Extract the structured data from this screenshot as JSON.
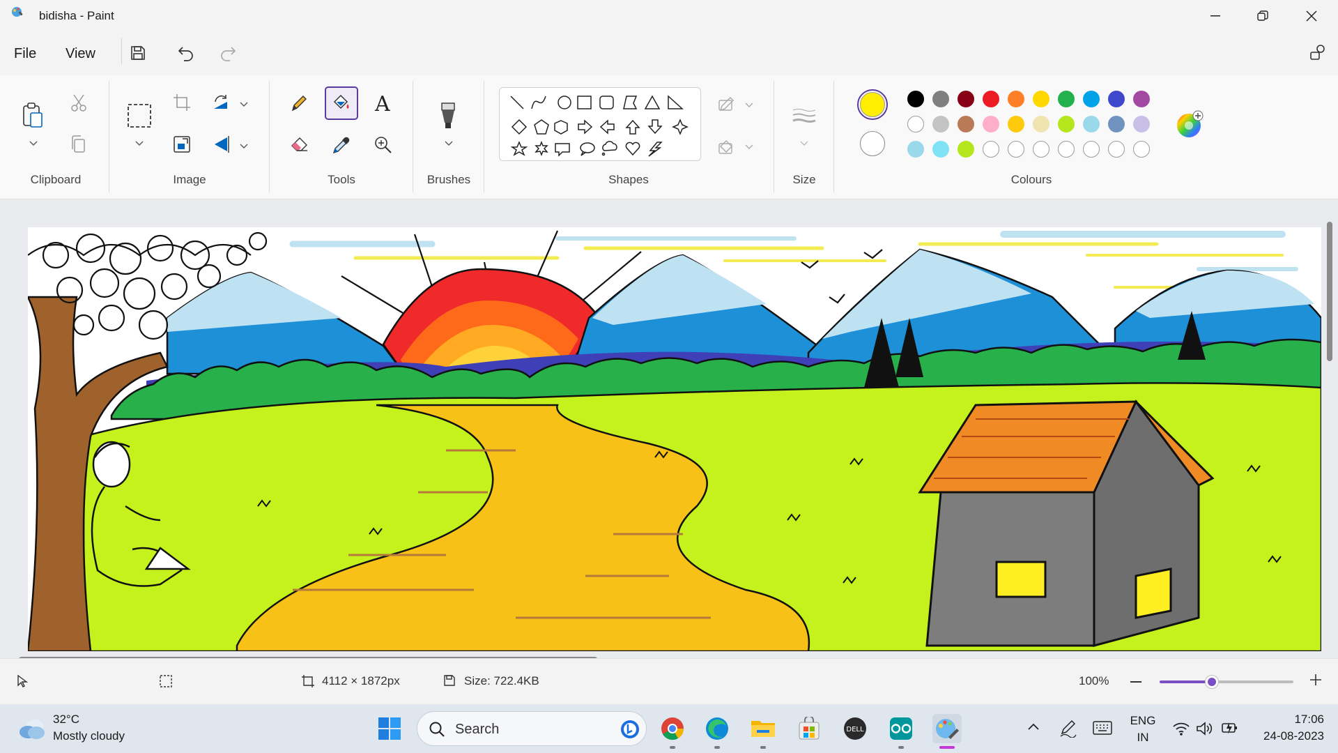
{
  "window": {
    "title": "bidisha - Paint"
  },
  "menu": {
    "file": "File",
    "view": "View"
  },
  "ribbon": {
    "groups": {
      "clipboard": "Clipboard",
      "image": "Image",
      "tools": "Tools",
      "brushes": "Brushes",
      "shapes": "Shapes",
      "size": "Size",
      "colours": "Colours"
    },
    "tools": {
      "text_tool": "A"
    },
    "active_tool": "fill-bucket",
    "colour1": "#FFEE00",
    "colour2": "#FFFFFF",
    "palette_row1": [
      "#000000",
      "#7f7f7f",
      "#880015",
      "#ed1c24",
      "#ff7f27",
      "#ffd800",
      "#22b14c",
      "#00a2e8",
      "#3f48cc",
      "#a349a4"
    ],
    "palette_row2": [
      "#ffffff",
      "#c3c3c3",
      "#b97a57",
      "#ffaec9",
      "#ffc90e",
      "#efe4b0",
      "#b5e61d",
      "#99d9ea",
      "#7092be",
      "#c8bfe7"
    ],
    "palette_row3": [
      "#99d9ea",
      "#7fe3f5",
      "#b5e61d",
      "empty",
      "empty",
      "empty",
      "empty",
      "empty",
      "empty",
      "empty"
    ]
  },
  "status": {
    "dimensions": "4112 × 1872px",
    "size": "Size: 722.4KB",
    "zoom": "100%"
  },
  "taskbar": {
    "temperature": "32°C",
    "weather": "Mostly cloudy",
    "search_placeholder": "Search",
    "lang1": "ENG",
    "lang2": "IN",
    "time": "17:06",
    "date": "24-08-2023"
  }
}
